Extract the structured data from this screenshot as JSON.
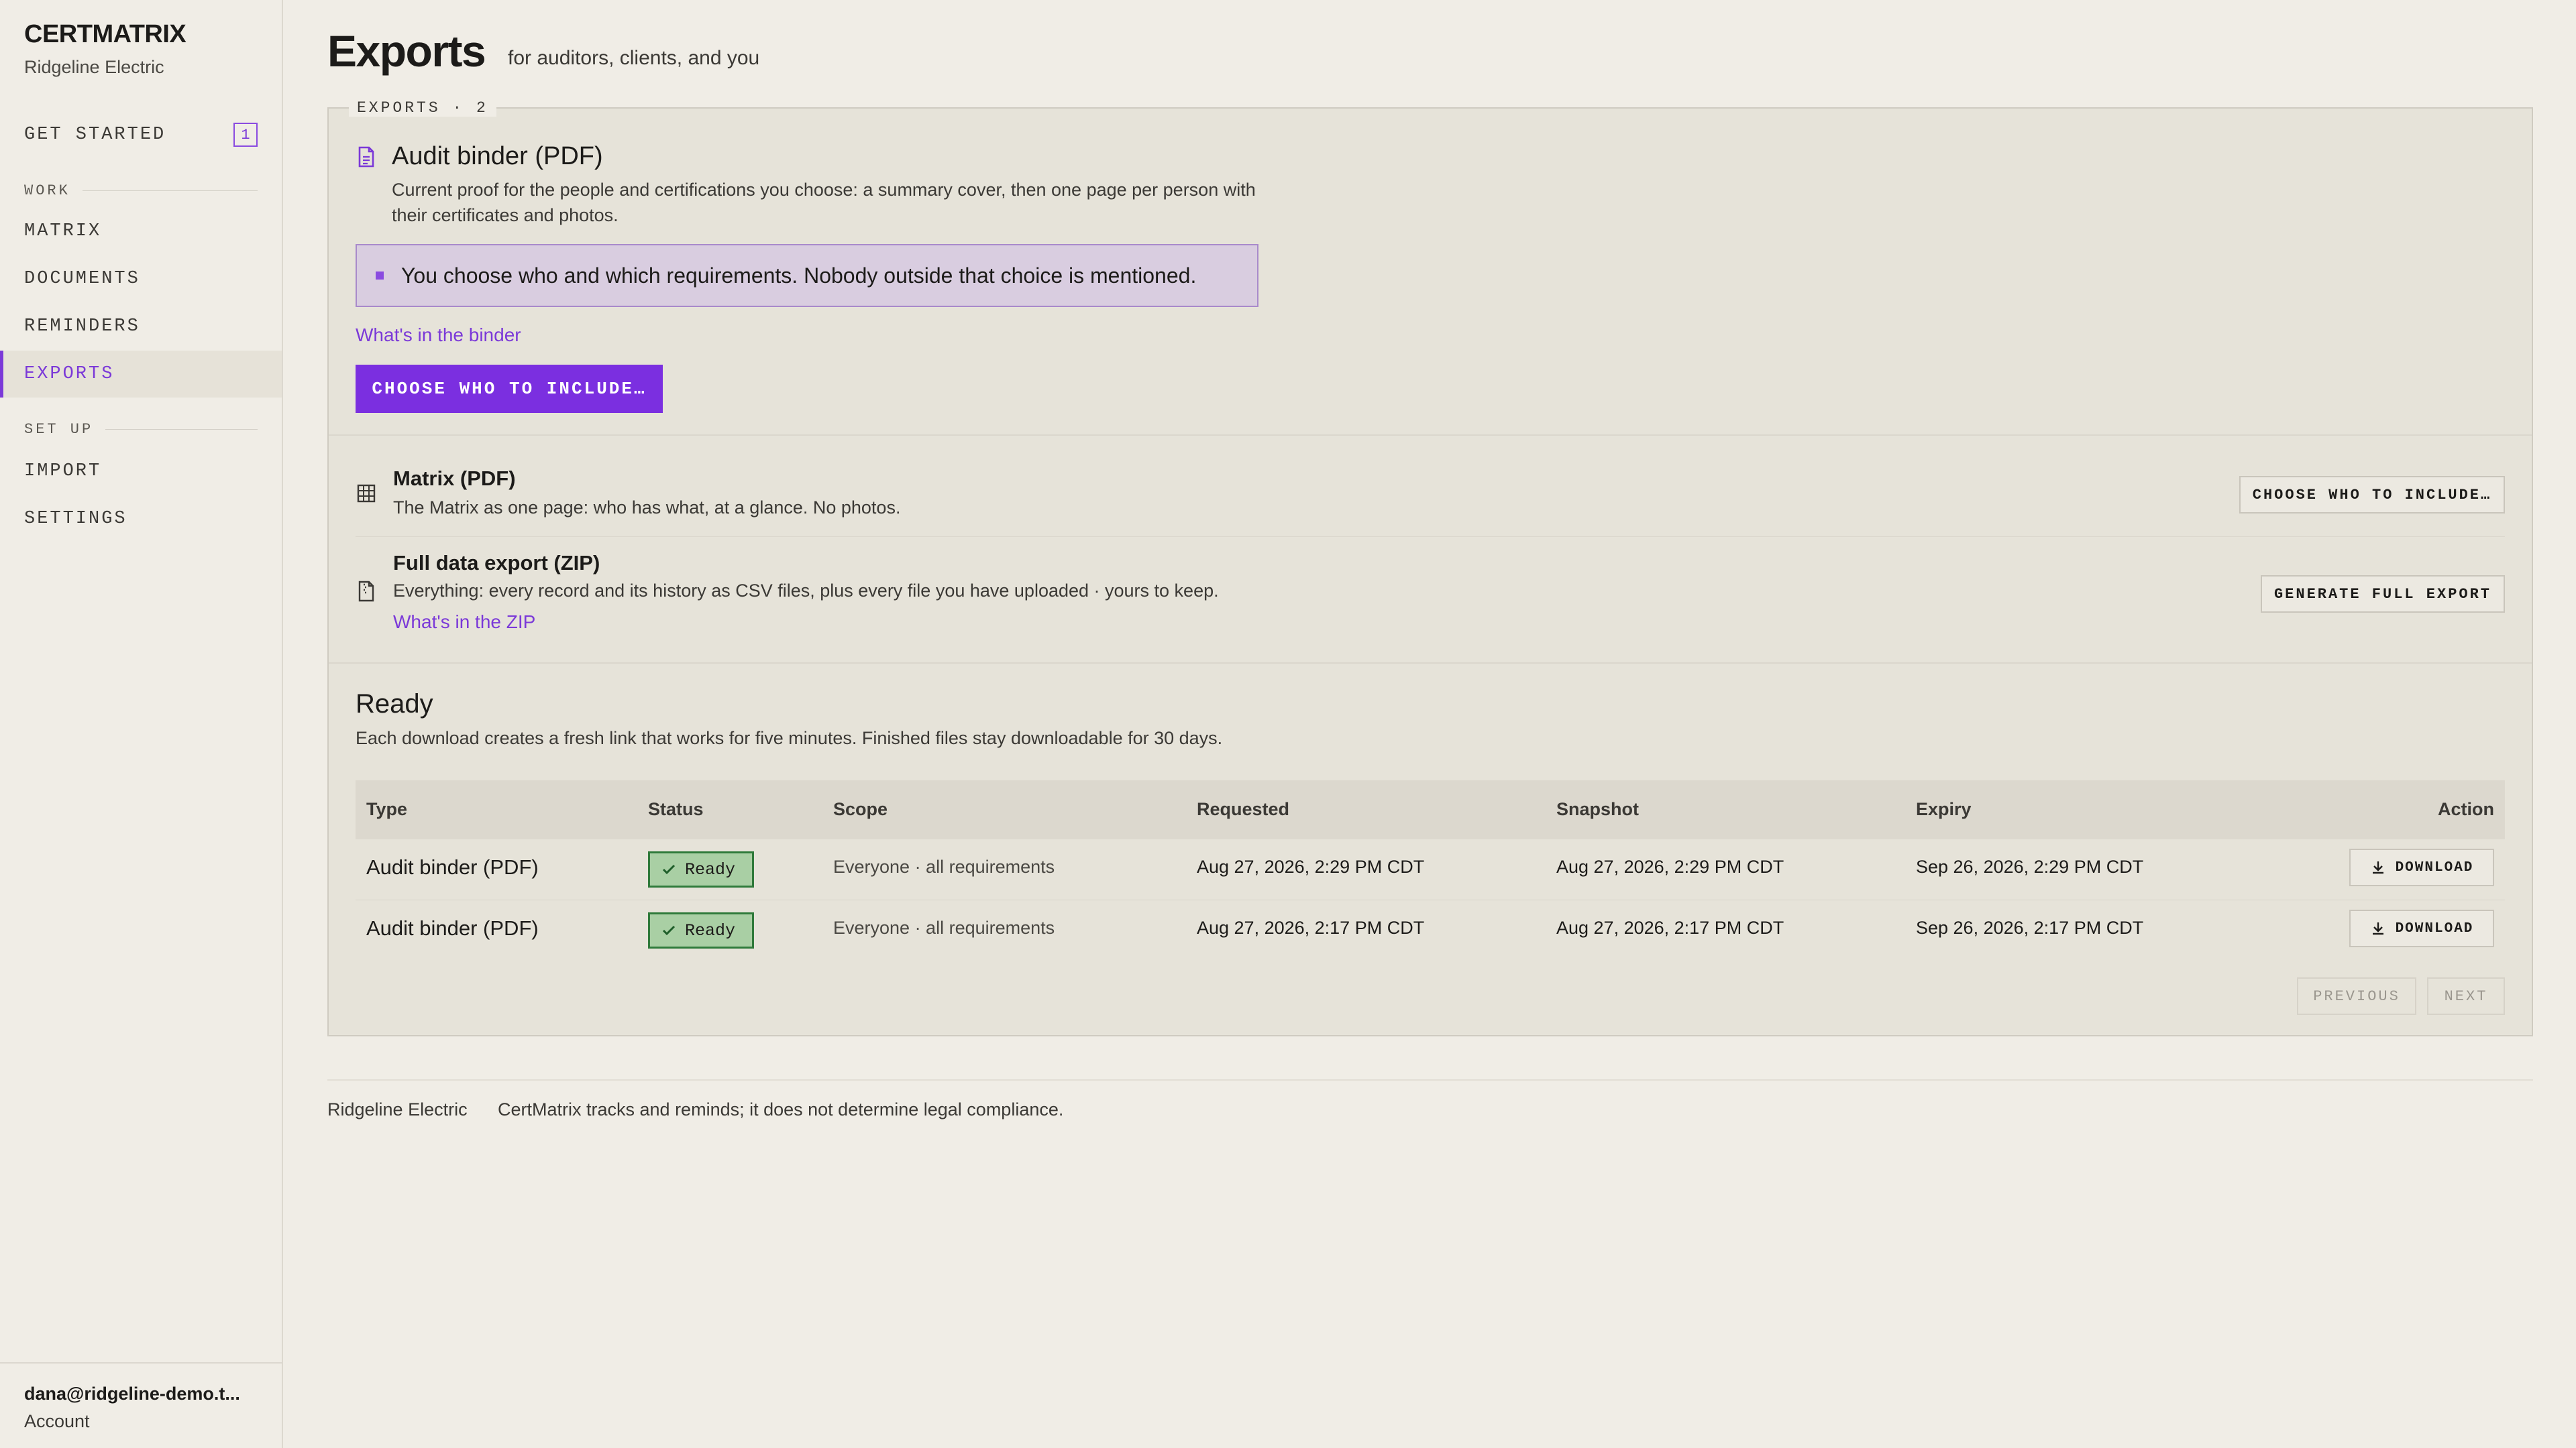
{
  "sidebar": {
    "brand": "CERTMATRIX",
    "org": "Ridgeline Electric",
    "get_started": {
      "label": "GET STARTED",
      "badge": "1"
    },
    "work_section": "WORK",
    "setup_section": "SET UP",
    "items": [
      {
        "label": "MATRIX"
      },
      {
        "label": "DOCUMENTS"
      },
      {
        "label": "REMINDERS"
      },
      {
        "label": "EXPORTS",
        "active": true
      },
      {
        "label": "IMPORT"
      },
      {
        "label": "SETTINGS"
      }
    ],
    "account": {
      "email": "dana@ridgeline-demo.t...",
      "link": "Account"
    }
  },
  "header": {
    "title": "Exports",
    "subtitle": "for auditors, clients, and you"
  },
  "panel": {
    "legend": "EXPORTS · 2",
    "binder": {
      "title": "Audit binder (PDF)",
      "description": "Current proof for the people and certifications you choose: a summary cover, then one page per person with their certificates and photos.",
      "callout": "You choose who and which requirements. Nobody outside that choice is mentioned.",
      "link": "What's in the binder",
      "button": "CHOOSE WHO TO INCLUDE…"
    },
    "matrix": {
      "title": "Matrix (PDF)",
      "description": "The Matrix as one page: who has what, at a glance. No photos.",
      "button": "CHOOSE WHO TO INCLUDE…"
    },
    "full_export": {
      "title": "Full data export (ZIP)",
      "description": "Everything: every record and its history as CSV files, plus every file you have uploaded · yours to keep.",
      "link": "What's in the ZIP",
      "button": "GENERATE FULL EXPORT"
    },
    "ready": {
      "title": "Ready",
      "description": "Each download creates a fresh link that works for five minutes. Finished files stay downloadable for 30 days.",
      "columns": [
        "Type",
        "Status",
        "Scope",
        "Requested",
        "Snapshot",
        "Expiry",
        "Action"
      ],
      "rows": [
        {
          "type": "Audit binder (PDF)",
          "status": "Ready",
          "scope": "Everyone · all requirements",
          "requested": "Aug 27, 2026, 2:29 PM CDT",
          "snapshot": "Aug 27, 2026, 2:29 PM CDT",
          "expiry": "Sep 26, 2026, 2:29 PM CDT",
          "action": "DOWNLOAD"
        },
        {
          "type": "Audit binder (PDF)",
          "status": "Ready",
          "scope": "Everyone · all requirements",
          "requested": "Aug 27, 2026, 2:17 PM CDT",
          "snapshot": "Aug 27, 2026, 2:17 PM CDT",
          "expiry": "Sep 26, 2026, 2:17 PM CDT",
          "action": "DOWNLOAD"
        }
      ],
      "pager": {
        "previous": "PREVIOUS",
        "next": "NEXT"
      }
    }
  },
  "footer": {
    "org": "Ridgeline Electric",
    "note": "CertMatrix tracks and reminds; it does not determine legal compliance."
  },
  "colors": {
    "accent": "#7b2fe0",
    "ready_fill": "#a9cfa4",
    "ready_border": "#2f7a3a",
    "callout_fill": "#d9cde0"
  }
}
